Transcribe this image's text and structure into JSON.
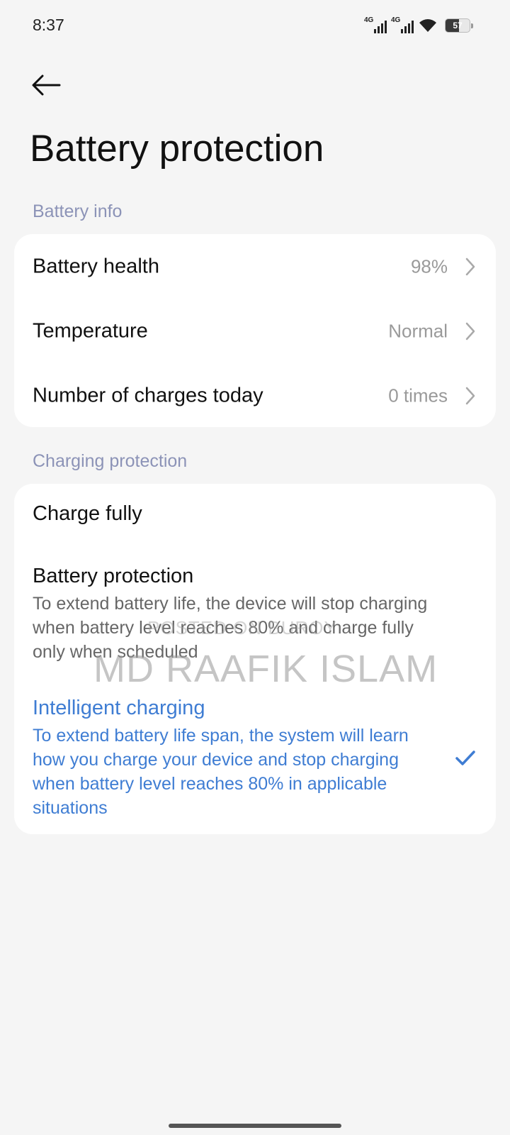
{
  "status_bar": {
    "time": "8:37",
    "sim1_network": "4G",
    "sim2_network": "4G",
    "battery_level": "57",
    "icons": [
      "signal-icon",
      "signal-icon",
      "wifi-icon",
      "battery-icon"
    ]
  },
  "header": {
    "back_icon": "arrow-left-icon",
    "title": "Battery protection"
  },
  "battery_info": {
    "section_title": "Battery info",
    "rows": [
      {
        "label": "Battery health",
        "value": "98%"
      },
      {
        "label": "Temperature",
        "value": "Normal"
      },
      {
        "label": "Number of charges today",
        "value": "0 times"
      }
    ]
  },
  "charging_protection": {
    "section_title": "Charging protection",
    "options": [
      {
        "title": "Charge fully",
        "description": "",
        "selected": false
      },
      {
        "title": "Battery protection",
        "description": "To extend battery life, the device will stop charging when battery level reaches 80% and charge fully only when scheduled",
        "selected": false
      },
      {
        "title": "Intelligent charging",
        "description": "To extend battery life span, the system will learn how you charge your device and stop charging when battery level reaches 80% in applicable situations",
        "selected": true
      }
    ]
  },
  "watermark": {
    "line1": "POSTED ON BUROY",
    "line2": "MD RAAFIK ISLAM"
  },
  "colors": {
    "background": "#f5f5f5",
    "card": "#ffffff",
    "section_header": "#8c93b7",
    "accent": "#3f7dd3",
    "secondary_text": "#9a9a9a"
  }
}
